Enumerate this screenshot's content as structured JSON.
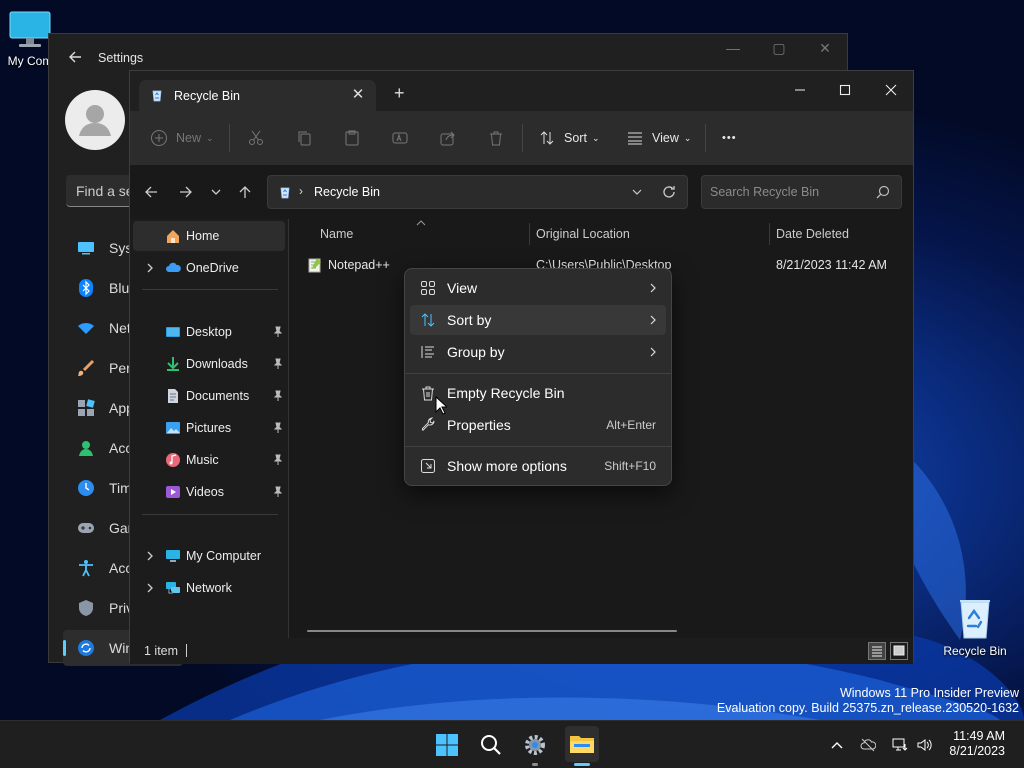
{
  "desktop": {
    "icons": [
      {
        "label": "My Com"
      },
      {
        "label": "Recycle Bin"
      }
    ],
    "watermark": {
      "line1": "Windows 11 Pro Insider Preview",
      "line2": "Evaluation copy. Build 25375.zn_release.230520-1632"
    }
  },
  "settings": {
    "title": "Settings",
    "search_placeholder": "Find a se",
    "nav": [
      {
        "label": "Syst",
        "icon": "system-icon"
      },
      {
        "label": "Blue",
        "icon": "bluetooth-icon"
      },
      {
        "label": "Net",
        "icon": "network-wifi-icon"
      },
      {
        "label": "Pers",
        "icon": "personalization-brush-icon"
      },
      {
        "label": "App",
        "icon": "apps-icon"
      },
      {
        "label": "Acc",
        "icon": "accounts-icon"
      },
      {
        "label": "Tim",
        "icon": "time-language-icon"
      },
      {
        "label": "Gan",
        "icon": "gaming-icon"
      },
      {
        "label": "Acc",
        "icon": "accessibility-icon"
      },
      {
        "label": "Priv",
        "icon": "privacy-shield-icon"
      },
      {
        "label": "Win",
        "icon": "windows-update-icon"
      }
    ]
  },
  "explorer": {
    "tab": {
      "label": "Recycle Bin",
      "close": "✕"
    },
    "new_tab": "+",
    "toolbar": {
      "new_label": "New",
      "sort_label": "Sort",
      "view_label": "View",
      "more": "•••"
    },
    "address": {
      "path": "Recycle Bin",
      "separator": "›"
    },
    "search": {
      "placeholder": "Search Recycle Bin"
    },
    "nav": {
      "home": "Home",
      "onedrive": "OneDrive",
      "quick": [
        "Desktop",
        "Downloads",
        "Documents",
        "Pictures",
        "Music",
        "Videos"
      ],
      "my_computer": "My Computer",
      "network": "Network"
    },
    "columns": [
      "Name",
      "Original Location",
      "Date Deleted"
    ],
    "rows": [
      {
        "name": "Notepad++",
        "location": "C:\\Users\\Public\\Desktop",
        "date": "8/21/2023 11:42 AM"
      }
    ],
    "status": {
      "count": "1 item"
    }
  },
  "context_menu": {
    "items": [
      {
        "label": "View",
        "icon": "view-grid-icon",
        "submenu": true
      },
      {
        "label": "Sort by",
        "icon": "sort-arrows-icon",
        "submenu": true
      },
      {
        "label": "Group by",
        "icon": "group-list-icon",
        "submenu": true
      },
      {
        "label": "Empty Recycle Bin",
        "icon": "trash-icon"
      },
      {
        "label": "Properties",
        "icon": "wrench-icon",
        "shortcut": "Alt+Enter"
      },
      {
        "label": "Show more options",
        "icon": "more-options-icon",
        "shortcut": "Shift+F10"
      }
    ]
  },
  "taskbar": {
    "time": "11:49 AM",
    "date": "8/21/2023"
  },
  "colors": {
    "accent": "#60cdff",
    "windows_blue": "#0078d4",
    "folder_yellow": "#f5c542"
  }
}
